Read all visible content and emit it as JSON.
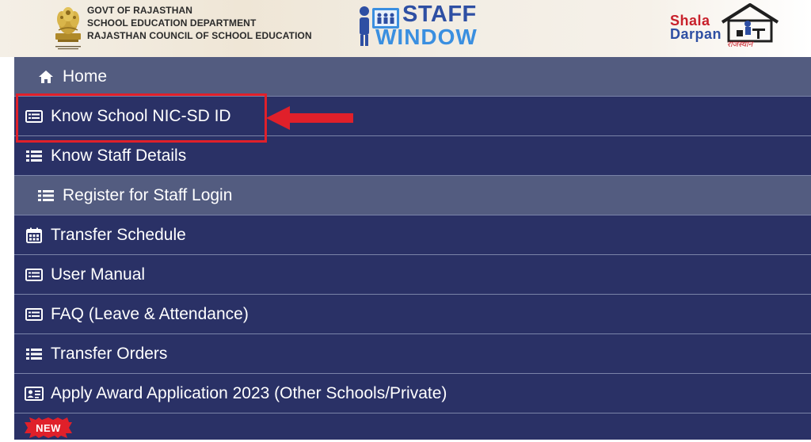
{
  "header": {
    "govt_line1": "GOVT OF RAJASTHAN",
    "govt_line2": "SCHOOL EDUCATION DEPARTMENT",
    "govt_line3": "RAJASTHAN COUNCIL OF SCHOOL EDUCATION",
    "emblem_icon": "state-emblem-icon",
    "staff_logo_word1": "STAFF",
    "staff_logo_word2": "WINDOW",
    "shala_logo_word1": "Shala",
    "shala_logo_word2": "Darpan",
    "shala_logo_word3": "राजस्थान",
    "accent_blue": "#2e4fa3",
    "accent_red": "#c8202a"
  },
  "menu": {
    "background_color": "#2a3166",
    "highlight_row_color": "#535c80",
    "items": [
      {
        "label": "Home",
        "icon": "home-icon"
      },
      {
        "label": "Know School NIC-SD ID",
        "icon": "list-alt-icon"
      },
      {
        "label": "Know Staff Details",
        "icon": "list-icon"
      },
      {
        "label": "Register for Staff Login",
        "icon": "list-icon"
      },
      {
        "label": "Transfer Schedule",
        "icon": "calendar-icon"
      },
      {
        "label": "User Manual",
        "icon": "list-alt-icon"
      },
      {
        "label": "FAQ (Leave & Attendance)",
        "icon": "list-alt-icon"
      },
      {
        "label": "Transfer Orders",
        "icon": "list-icon"
      },
      {
        "label": "Apply Award Application 2023 (Other Schools/Private)",
        "icon": "id-card-icon"
      }
    ]
  },
  "annotation": {
    "box_color": "#e0202a",
    "arrow_icon": "left-arrow-icon"
  },
  "badge": {
    "label": "NEW",
    "color": "#e0202a"
  }
}
